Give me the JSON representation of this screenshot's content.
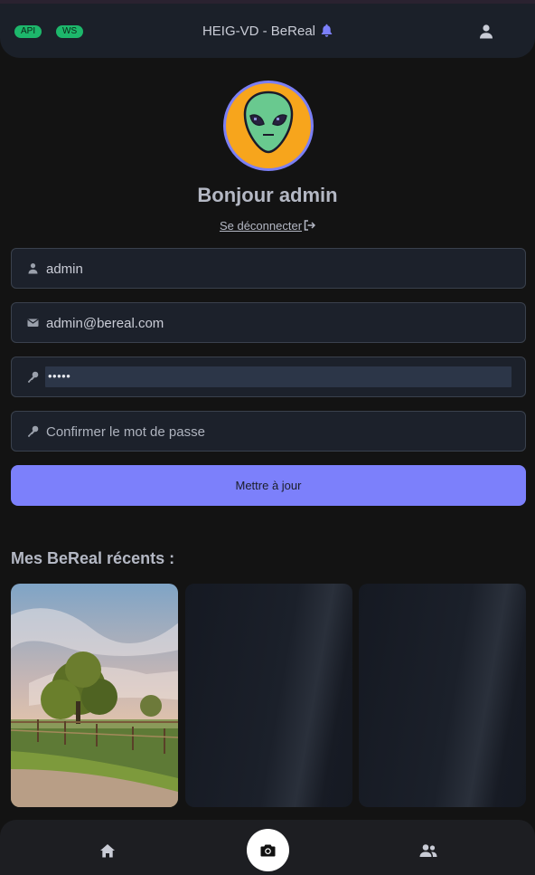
{
  "header": {
    "badges": [
      "API",
      "WS"
    ],
    "title": "HEIG-VD - BeReal",
    "icons": {
      "bell": "bell-icon",
      "user": "user-icon"
    },
    "badge_color": "#1db76b"
  },
  "profile": {
    "avatar": "alien-avatar",
    "greeting": "Bonjour admin",
    "logout_label": "Se déconnecter",
    "logout_icon": "logout-icon"
  },
  "form": {
    "username": {
      "value": "admin",
      "icon": "user-icon"
    },
    "email": {
      "value": "admin@bereal.com",
      "icon": "envelope-icon"
    },
    "password": {
      "value": "•••••",
      "icon": "key-icon"
    },
    "confirm_password": {
      "placeholder": "Confirmer le mot de passe",
      "icon": "key-icon"
    },
    "submit_label": "Mettre à jour",
    "accent_color": "#7c80fb"
  },
  "recent": {
    "title": "Mes BeReal récents :"
  },
  "bottom_nav": {
    "items": [
      "home-icon",
      "camera-icon",
      "friends-icon"
    ]
  }
}
